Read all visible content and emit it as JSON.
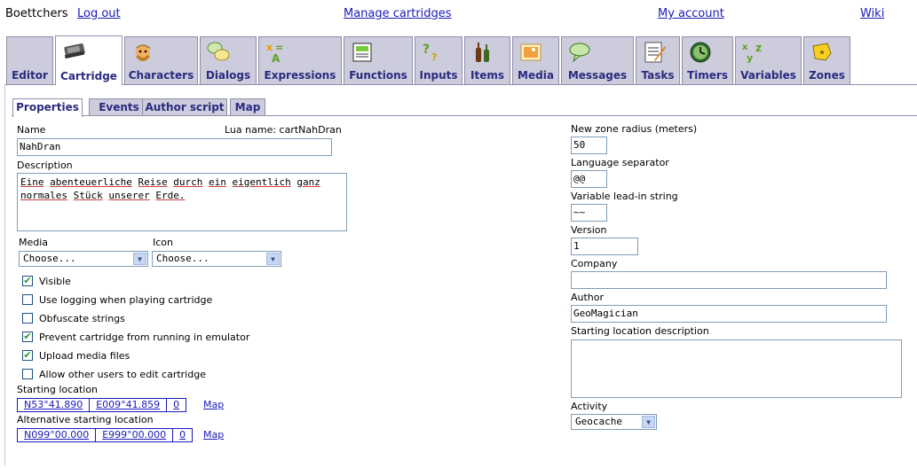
{
  "topbar": {
    "user": "Boettchers",
    "logout": "Log out",
    "manage": "Manage cartridges",
    "account": "My account",
    "wiki": "Wiki"
  },
  "main_tabs": [
    {
      "label": "Editor",
      "icon": "editor-icon"
    },
    {
      "label": "Cartridge",
      "icon": "cartridge-icon",
      "active": true
    },
    {
      "label": "Characters",
      "icon": "characters-icon"
    },
    {
      "label": "Dialogs",
      "icon": "dialogs-icon"
    },
    {
      "label": "Expressions",
      "icon": "expressions-icon"
    },
    {
      "label": "Functions",
      "icon": "functions-icon"
    },
    {
      "label": "Inputs",
      "icon": "inputs-icon"
    },
    {
      "label": "Items",
      "icon": "items-icon"
    },
    {
      "label": "Media",
      "icon": "media-icon"
    },
    {
      "label": "Messages",
      "icon": "messages-icon"
    },
    {
      "label": "Tasks",
      "icon": "tasks-icon"
    },
    {
      "label": "Timers",
      "icon": "timers-icon"
    },
    {
      "label": "Variables",
      "icon": "variables-icon"
    },
    {
      "label": "Zones",
      "icon": "zones-icon"
    }
  ],
  "sub_tabs": [
    {
      "label": "Properties",
      "active": true
    },
    {
      "label": "Events"
    },
    {
      "label": "Author script"
    },
    {
      "label": "Map"
    }
  ],
  "form": {
    "name_label": "Name",
    "lua_name": "Lua name: cartNahDran",
    "name_value": "NahDran",
    "description_label": "Description",
    "description_line1": [
      "Eine",
      "abenteuerliche",
      "Reise",
      "durch",
      "ein",
      "eigentlich",
      "ganz"
    ],
    "description_line2": [
      "normales",
      "Stück",
      "unserer",
      "Erde."
    ],
    "media_label": "Media",
    "media_value": "Choose...",
    "icon_label": "Icon",
    "icon_value": "Choose...",
    "checkboxes": [
      {
        "label": "Visible",
        "checked": true
      },
      {
        "label": "Use logging when playing cartridge",
        "checked": false
      },
      {
        "label": "Obfuscate strings",
        "checked": false
      },
      {
        "label": "Prevent cartridge from running in emulator",
        "checked": true
      },
      {
        "label": "Upload media files",
        "checked": true
      },
      {
        "label": "Allow other users to edit cartridge",
        "checked": false
      }
    ],
    "starting_location_label": "Starting location",
    "starting_location": {
      "lat": "N53°41.890",
      "lon": "E009°41.859",
      "alt": "0",
      "map": "Map"
    },
    "alt_starting_location_label": "Alternative starting location",
    "alt_starting_location": {
      "lat": "N099°00.000",
      "lon": "E999°00.000",
      "alt": "0",
      "map": "Map"
    },
    "zone_radius_label": "New zone radius (meters)",
    "zone_radius_value": "50",
    "lang_sep_label": "Language separator",
    "lang_sep_value": "@@",
    "var_leadin_label": "Variable lead-in string",
    "var_leadin_value": "~~",
    "version_label": "Version",
    "version_value": "1",
    "company_label": "Company",
    "company_value": "",
    "author_label": "Author",
    "author_value": "GeoMagician",
    "start_desc_label": "Starting location description",
    "start_desc_value": "",
    "activity_label": "Activity",
    "activity_value": "Geocache"
  },
  "colors": {
    "link": "#1a1ab8",
    "tab_bg": "#ccccdc",
    "tab_text": "#2a2a80",
    "check": "#21a121"
  }
}
